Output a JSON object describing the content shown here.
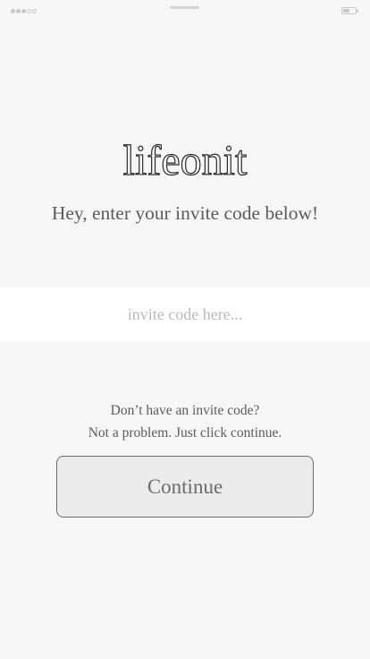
{
  "status_bar": {
    "signal_icon": "signal-dots-icon",
    "signal_strength": "3 of 5",
    "battery_icon": "battery-icon",
    "color": "#c8c8c8"
  },
  "logo": {
    "text": "lifeonit"
  },
  "subtitle": "Hey, enter your invite code below!",
  "invite_input": {
    "value": "",
    "placeholder": "invite code here..."
  },
  "hint": {
    "line1": "Don’t have an invite code?",
    "line2": "Not a problem. Just click continue."
  },
  "continue_button": {
    "label": "Continue"
  },
  "colors": {
    "background": "#f6f6f6",
    "input_band": "#ffffff",
    "button_fill": "#ebebeb",
    "button_border": "#6a6a6a",
    "text": "#5b5b5b",
    "placeholder": "#b9b9b9"
  }
}
